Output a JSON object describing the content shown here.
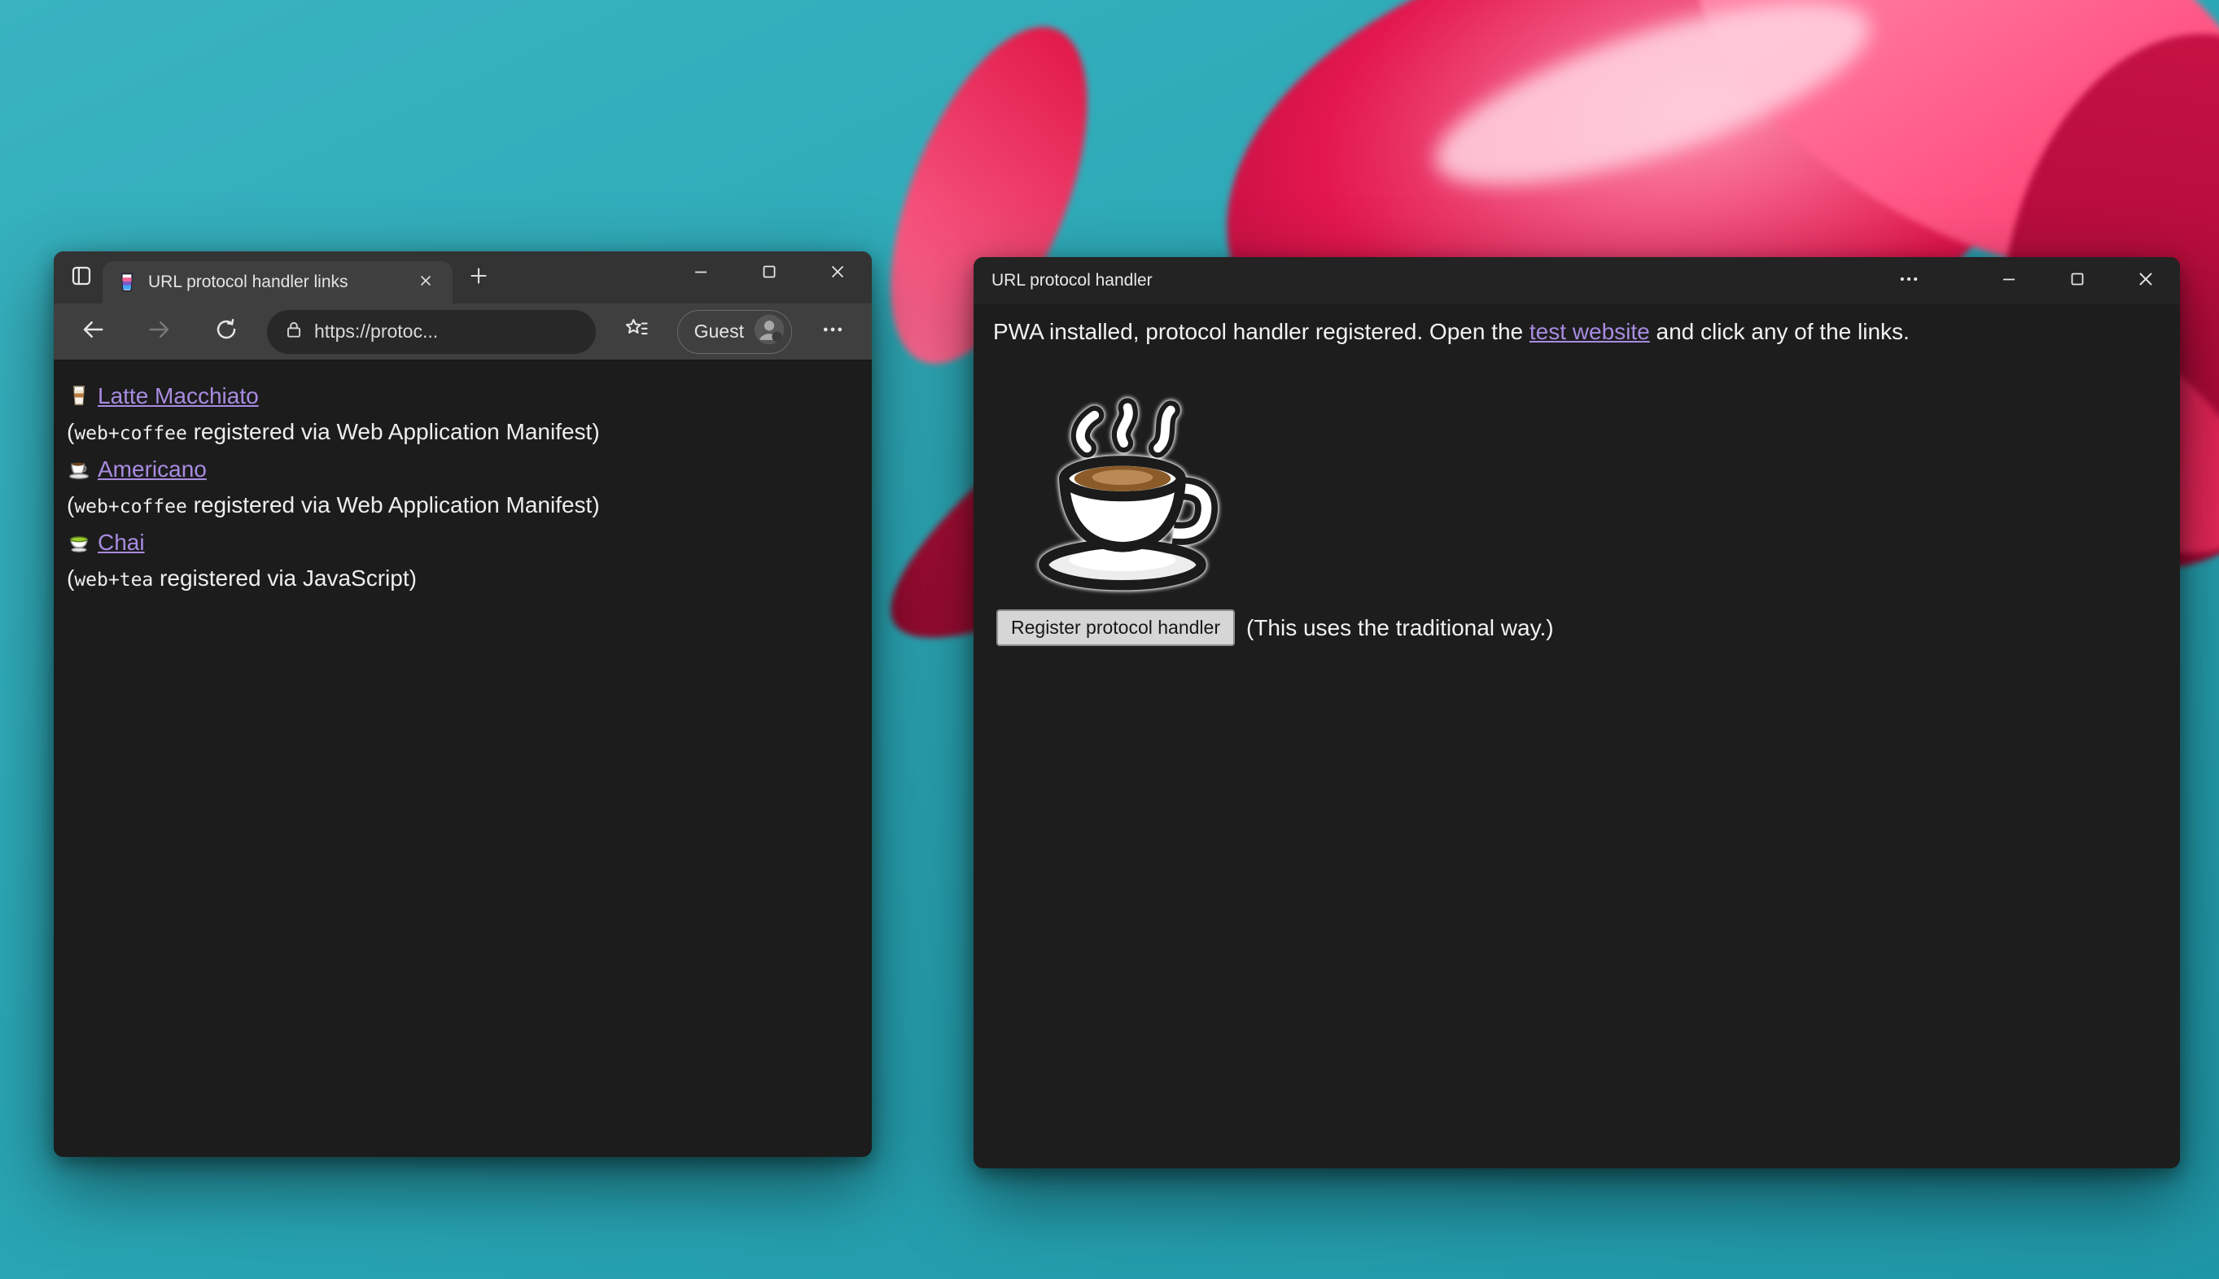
{
  "wallpaper": {
    "description": "teal desktop with abstract red flower petals",
    "teal": "#2aa7b5",
    "petal_red": "#e3174f"
  },
  "colors": {
    "link": "#a88be0",
    "chrome_dark": "#3f3f3f",
    "page_background": "#1c1c1c"
  },
  "browser_window": {
    "tabstrip": {
      "tab_actions_icon": "tab-actions-menu-icon",
      "tab": {
        "favicon_icon": "layered-drink-favicon-icon",
        "title": "URL protocol handler links",
        "close_icon": "close-icon"
      },
      "new_tab_icon": "plus-icon"
    },
    "window_controls": {
      "minimize_icon": "minimize-icon",
      "maximize_icon": "maximize-icon",
      "close_icon": "close-icon"
    },
    "toolbar": {
      "back_icon": "back-arrow-icon",
      "forward_icon": "forward-arrow-icon",
      "refresh_icon": "refresh-icon",
      "lock_icon": "lock-icon",
      "url": "https://protoc...",
      "favorites_icon": "favorites-star-icon",
      "profile_label": "Guest",
      "avatar_icon": "guest-avatar-icon",
      "menu_icon": "ellipsis-icon"
    },
    "page": {
      "links": [
        {
          "icon": "latte-glass-icon",
          "label": "Latte Macchiato",
          "note_prefix": "(",
          "note_code": "web+coffee",
          "note_suffix": " registered via Web Application Manifest)"
        },
        {
          "icon": "coffee-cup-icon",
          "label": "Americano",
          "note_prefix": "(",
          "note_code": "web+coffee",
          "note_suffix": " registered via Web Application Manifest)"
        },
        {
          "icon": "teacup-icon",
          "label": "Chai",
          "note_prefix": "(",
          "note_code": "web+tea",
          "note_suffix": " registered via JavaScript)"
        }
      ]
    }
  },
  "pwa_window": {
    "title": "URL protocol handler",
    "window_controls": {
      "menu_icon": "ellipsis-icon",
      "minimize_icon": "minimize-icon",
      "maximize_icon": "maximize-icon",
      "close_icon": "close-icon"
    },
    "intro_before": "PWA installed, protocol handler registered. Open the ",
    "intro_link": "test website",
    "intro_after": " and click any of the links.",
    "hero_icon": "hot-beverage-emoji",
    "register_button_label": "Register protocol handler",
    "register_note": "(This uses the traditional way.)"
  }
}
